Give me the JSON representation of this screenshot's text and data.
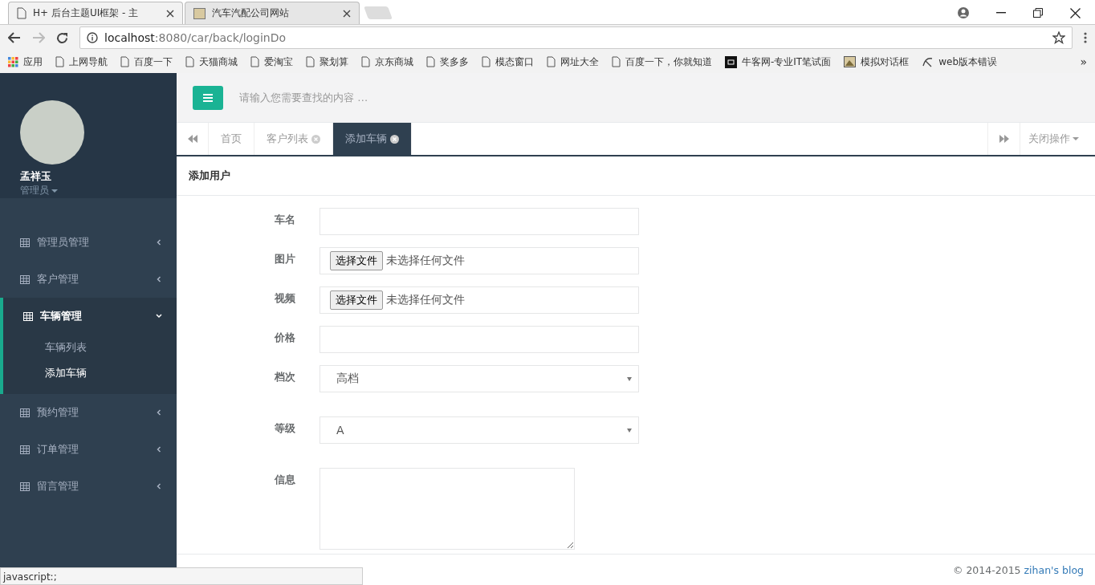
{
  "browser": {
    "tabs": [
      {
        "title": "H+ 后台主题UI框架 - 主",
        "selected": true
      },
      {
        "title": "汽车汽配公司网站",
        "selected": false
      }
    ],
    "address": {
      "host": "localhost",
      "path": ":8080/car/back/loginDo"
    },
    "bookmarks": [
      {
        "label": "应用",
        "kind": "apps"
      },
      {
        "label": "上网导航",
        "kind": "page"
      },
      {
        "label": "百度一下",
        "kind": "page"
      },
      {
        "label": "天猫商城",
        "kind": "page"
      },
      {
        "label": "爱淘宝",
        "kind": "page"
      },
      {
        "label": "聚划算",
        "kind": "page"
      },
      {
        "label": "京东商城",
        "kind": "page"
      },
      {
        "label": "奖多多",
        "kind": "page"
      },
      {
        "label": "模态窗口",
        "kind": "page"
      },
      {
        "label": "网址大全",
        "kind": "page"
      },
      {
        "label": "百度一下，你就知道",
        "kind": "page"
      },
      {
        "label": "牛客网-专业IT笔试面",
        "kind": "logo"
      },
      {
        "label": "模拟对话框",
        "kind": "image"
      },
      {
        "label": "web版本错误",
        "kind": "script"
      }
    ],
    "more_label": "»",
    "status_text": "javascript:;"
  },
  "sidebar": {
    "user_name": "孟祥玉",
    "role": "管理员",
    "items": [
      {
        "label": "管理员管理",
        "expanded": false
      },
      {
        "label": "客户管理",
        "expanded": false
      },
      {
        "label": "车辆管理",
        "expanded": true,
        "children": [
          {
            "label": "车辆列表",
            "selected": false
          },
          {
            "label": "添加车辆",
            "selected": true
          }
        ]
      },
      {
        "label": "预约管理",
        "expanded": false
      },
      {
        "label": "订单管理",
        "expanded": false
      },
      {
        "label": "留言管理",
        "expanded": false
      }
    ]
  },
  "topbar": {
    "search": {
      "placeholder": "请输入您需要查找的内容 …"
    }
  },
  "page_tabs": {
    "tabs": [
      {
        "label": "首页",
        "selected": false,
        "closable": false
      },
      {
        "label": "客户列表",
        "selected": false,
        "closable": true
      },
      {
        "label": "添加车辆",
        "selected": true,
        "closable": true
      }
    ],
    "close_menu": "关闭操作"
  },
  "form": {
    "title": "添加用户",
    "fields": [
      {
        "label": "车名",
        "kind": "text"
      },
      {
        "label": "图片",
        "kind": "file",
        "button": "选择文件",
        "status": "未选择任何文件"
      },
      {
        "label": "视频",
        "kind": "file",
        "button": "选择文件",
        "status": "未选择任何文件"
      },
      {
        "label": "价格",
        "kind": "text"
      },
      {
        "label": "档次",
        "kind": "select",
        "value": "高档"
      },
      {
        "label": "等级",
        "kind": "select",
        "value": "A"
      },
      {
        "label": "信息",
        "kind": "textarea"
      }
    ]
  },
  "footer": {
    "copyright": "© 2014-2015",
    "link": "zihan's blog"
  }
}
